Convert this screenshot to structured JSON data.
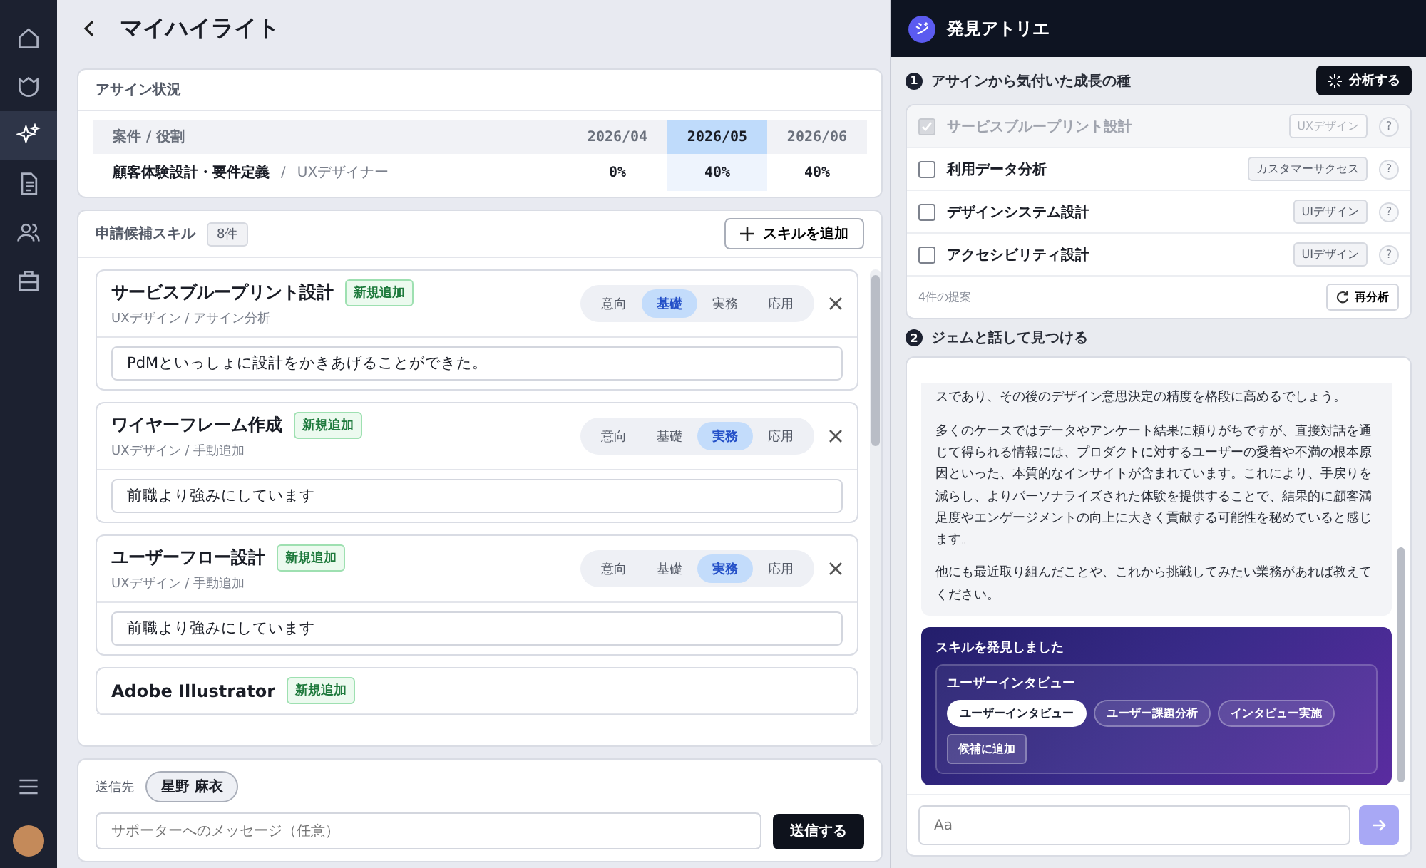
{
  "sidebar": {
    "items": [
      {
        "selected": false
      },
      {
        "selected": false
      },
      {
        "selected": true
      },
      {
        "selected": false
      },
      {
        "selected": false
      },
      {
        "selected": false
      }
    ]
  },
  "page": {
    "title": "マイハイライト"
  },
  "assign": {
    "title": "アサイン状況",
    "columns": [
      {
        "label": "案件 / 役割",
        "selected": false
      },
      {
        "label": "2026/04",
        "selected": false
      },
      {
        "label": "2026/05",
        "selected": true
      },
      {
        "label": "2026/06",
        "selected": false
      }
    ],
    "rows": [
      {
        "project": "顧客体験設計・要件定義",
        "separator": "/",
        "role": "UXデザイナー",
        "values": [
          "0%",
          "40%",
          "40%"
        ]
      }
    ]
  },
  "skills": {
    "title": "申請候補スキル",
    "count": "8件",
    "add_button": "スキルを追加",
    "cards": [
      {
        "title": "サービスブループリント設計",
        "badge": "新規追加",
        "sub": "UXデザイン / アサイン分析",
        "levels": [
          {
            "label": "意向",
            "selected": false
          },
          {
            "label": "基礎",
            "selected": true
          },
          {
            "label": "実務",
            "selected": false
          },
          {
            "label": "応用",
            "selected": false
          }
        ],
        "note": "PdMといっしょに設計をかきあげることができた。"
      },
      {
        "title": "ワイヤーフレーム作成",
        "badge": "新規追加",
        "sub": "UXデザイン / 手動追加",
        "levels": [
          {
            "label": "意向",
            "selected": false
          },
          {
            "label": "基礎",
            "selected": false
          },
          {
            "label": "実務",
            "selected": true
          },
          {
            "label": "応用",
            "selected": false
          }
        ],
        "note": "前職より強みにしています"
      },
      {
        "title": "ユーザーフロー設計",
        "badge": "新規追加",
        "sub": "UXデザイン / 手動追加",
        "levels": [
          {
            "label": "意向",
            "selected": false
          },
          {
            "label": "基礎",
            "selected": false
          },
          {
            "label": "実務",
            "selected": true
          },
          {
            "label": "応用",
            "selected": false
          }
        ],
        "note": "前職より強みにしています"
      },
      {
        "title": "Adobe Illustrator",
        "badge": "新規追加"
      }
    ]
  },
  "send": {
    "label": "送信先",
    "recipient": "星野 麻衣",
    "placeholder": "サポーターへのメッセージ（任意）",
    "button": "送信する"
  },
  "atelier": {
    "avatar": "ジ",
    "title": "発見アトリエ",
    "section1": {
      "number": "1",
      "title": "アサインから気付いた成長の種",
      "button": "分析する",
      "items": [
        {
          "label": "サービスブループリント設計",
          "tag": "UXデザイン",
          "checked": true,
          "disabled": true,
          "help": "?"
        },
        {
          "label": "利用データ分析",
          "tag": "カスタマーサクセス",
          "checked": false,
          "disabled": false,
          "help": "?"
        },
        {
          "label": "デザインシステム設計",
          "tag": "UIデザイン",
          "checked": false,
          "disabled": false,
          "help": "?"
        },
        {
          "label": "アクセシビリティ設計",
          "tag": "UIデザイン",
          "checked": false,
          "disabled": false,
          "help": "?"
        }
      ],
      "footer": "4件の提案",
      "reanalyze": "再分析"
    },
    "section2": {
      "number": "2",
      "title": "ジェムと話して見つける",
      "message": [
        "スであり、その後のデザイン意思決定の精度を格段に高めるでしょう。",
        "多くのケースではデータやアンケート結果に頼りがちですが、直接対話を通じて得られる情報には、プロダクトに対するユーザーの愛着や不満の根本原因といった、本質的なインサイトが含まれています。これにより、手戻りを減らし、よりパーソナライズされた体験を提供することで、結果的に顧客満足度やエンゲージメントの向上に大きく貢献する可能性を秘めていると感じます。",
        "他にも最近取り組んだことや、これから挑戦してみたい業務があれば教えてください。"
      ],
      "discovery": {
        "title": "スキルを発見しました",
        "group": "ユーザーインタビュー",
        "chips": [
          {
            "label": "ユーザーインタビュー",
            "selected": true
          },
          {
            "label": "ユーザー課題分析",
            "selected": false
          },
          {
            "label": "インタビュー実施",
            "selected": false
          }
        ],
        "add": "候補に追加"
      },
      "input_placeholder": "Aa"
    }
  }
}
